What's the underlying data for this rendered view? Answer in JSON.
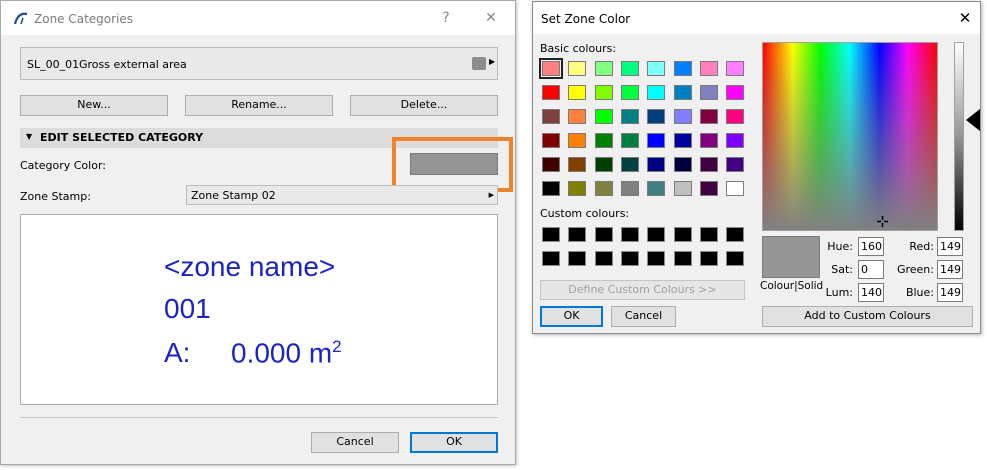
{
  "zone_categories": {
    "title": "Zone Categories",
    "titlebar_buttons": {
      "help": "?",
      "close": "✕"
    },
    "category": {
      "code": "SL_00_01",
      "name": "Gross external area",
      "color": "#8c8c8c"
    },
    "buttons": {
      "new": "New...",
      "rename": "Rename...",
      "delete": "Delete..."
    },
    "section_title": "EDIT SELECTED CATEGORY",
    "category_color_label": "Category Color:",
    "category_color_value": "#959595",
    "zone_stamp_label": "Zone Stamp:",
    "zone_stamp_value": "Zone Stamp 02",
    "preview": {
      "line1": "<zone name>",
      "line2": "001",
      "area_label": "A:",
      "area_value": "0.000 m",
      "area_unit_sup": "2"
    },
    "cancel_label": "Cancel",
    "ok_label": "OK"
  },
  "set_zone_color": {
    "title": "Set Zone Color",
    "close_glyph": "✕",
    "basic_colours_label": "Basic colours:",
    "basic_colours": [
      "#ff8080",
      "#ffff80",
      "#80ff80",
      "#00ff80",
      "#80ffff",
      "#0080ff",
      "#ff80c0",
      "#ff80ff",
      "#ff0000",
      "#ffff00",
      "#80ff00",
      "#00ff40",
      "#00ffff",
      "#0080c0",
      "#8080c0",
      "#ff00ff",
      "#804040",
      "#ff8040",
      "#00ff00",
      "#008080",
      "#004080",
      "#8080ff",
      "#800040",
      "#ff0080",
      "#800000",
      "#ff8000",
      "#008000",
      "#008040",
      "#0000ff",
      "#0000a0",
      "#800080",
      "#8000ff",
      "#400000",
      "#804000",
      "#004000",
      "#004040",
      "#000080",
      "#000040",
      "#400040",
      "#400080",
      "#000000",
      "#808000",
      "#808040",
      "#808080",
      "#408080",
      "#c0c0c0",
      "#400040",
      "#ffffff"
    ],
    "custom_colours_label": "Custom colours:",
    "custom_colours": [
      "#000000",
      "#000000",
      "#000000",
      "#000000",
      "#000000",
      "#000000",
      "#000000",
      "#000000",
      "#000000",
      "#000000",
      "#000000",
      "#000000",
      "#000000",
      "#000000",
      "#000000",
      "#000000"
    ],
    "define_custom_label": "Define Custom Colours >>",
    "ok_label": "OK",
    "cancel_label": "Cancel",
    "colour_solid_label": "Colour|Solid",
    "hue_label": "Hue:",
    "hue": "160",
    "sat_label": "Sat:",
    "sat": "0",
    "lum_label": "Lum:",
    "lum": "140",
    "red_label": "Red:",
    "red": "149",
    "green_label": "Green:",
    "green": "149",
    "blue_label": "Blue:",
    "blue": "149",
    "add_custom_label": "Add to Custom Colours",
    "current_color": "#959595"
  },
  "highlight_color": "#f0832a"
}
